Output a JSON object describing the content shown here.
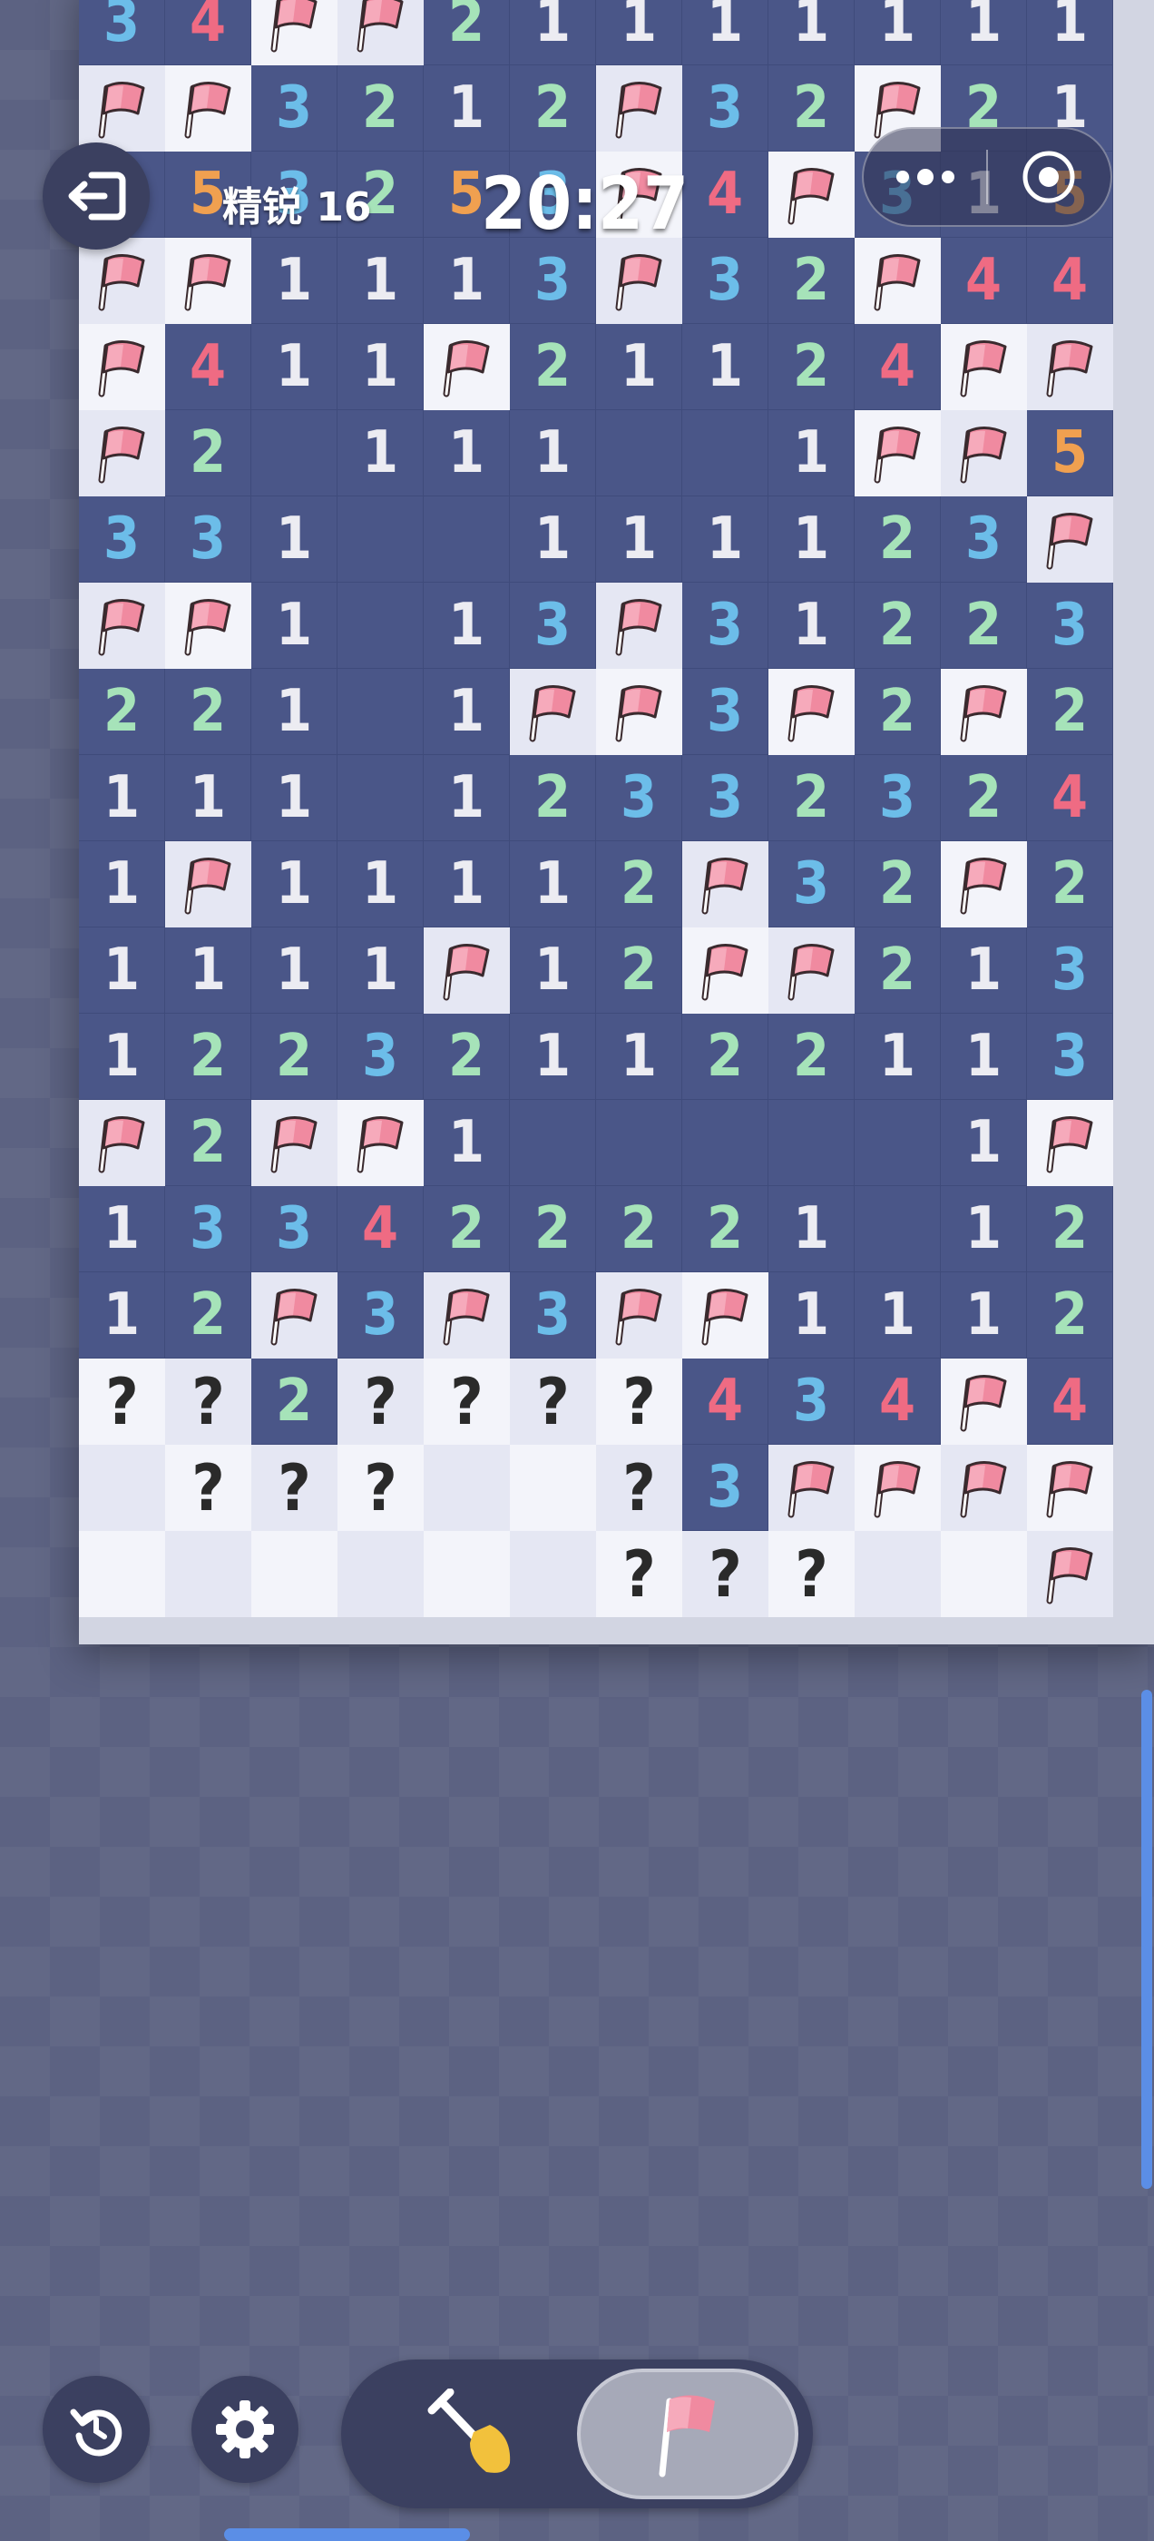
{
  "header": {
    "exit_icon": "exit-icon",
    "level_label": "精锐 16",
    "timer": "20:27",
    "capsule": {
      "more_icon": "more-dots-icon",
      "target_icon": "target-circle-icon"
    }
  },
  "board": {
    "legend": {
      "F": "flag",
      "?": "question-mark",
      ".": "hidden-blank",
      "_": "open-blank",
      "1-5": "number"
    },
    "rows": [
      [
        "3",
        "4",
        "F",
        "F",
        "2",
        "1",
        "1",
        "1",
        "1",
        "1",
        "1",
        "1"
      ],
      [
        "F",
        "F",
        "3",
        "2",
        "1",
        "2",
        "F",
        "3",
        "2",
        "F",
        "2",
        "1"
      ],
      [
        "5",
        "5",
        "3",
        "2",
        "5",
        "3",
        "F",
        "4",
        "F",
        "3",
        "1",
        "5"
      ],
      [
        "F",
        "F",
        "1",
        "1",
        "1",
        "3",
        "F",
        "3",
        "2",
        "F",
        "4",
        "4"
      ],
      [
        "F",
        "4",
        "1",
        "1",
        "F",
        "2",
        "1",
        "1",
        "2",
        "4",
        "F",
        "F"
      ],
      [
        "F",
        "2",
        "_",
        "1",
        "1",
        "1",
        "_",
        "_",
        "1",
        "F",
        "F",
        "5"
      ],
      [
        "3",
        "3",
        "1",
        "_",
        "_",
        "1",
        "1",
        "1",
        "1",
        "2",
        "3",
        "F"
      ],
      [
        "F",
        "F",
        "1",
        "_",
        "1",
        "3",
        "F",
        "3",
        "1",
        "2",
        "2",
        "3"
      ],
      [
        "2",
        "2",
        "1",
        "_",
        "1",
        "F",
        "F",
        "3",
        "F",
        "2",
        "F",
        "2"
      ],
      [
        "1",
        "1",
        "1",
        "_",
        "1",
        "2",
        "3",
        "3",
        "2",
        "3",
        "2",
        "4"
      ],
      [
        "1",
        "F",
        "1",
        "1",
        "1",
        "1",
        "2",
        "F",
        "3",
        "2",
        "F",
        "2"
      ],
      [
        "1",
        "1",
        "1",
        "1",
        "F",
        "1",
        "2",
        "F",
        "F",
        "2",
        "1",
        "3"
      ],
      [
        "1",
        "2",
        "2",
        "3",
        "2",
        "1",
        "1",
        "2",
        "2",
        "1",
        "1",
        "3"
      ],
      [
        "F",
        "2",
        "F",
        "F",
        "1",
        "_",
        "_",
        "_",
        "_",
        "_",
        "1",
        "F"
      ],
      [
        "1",
        "3",
        "3",
        "4",
        "2",
        "2",
        "2",
        "2",
        "1",
        "_",
        "1",
        "2"
      ],
      [
        "1",
        "2",
        "F",
        "3",
        "F",
        "3",
        "F",
        "F",
        "1",
        "1",
        "1",
        "2"
      ],
      [
        "?",
        "?",
        "2",
        "?",
        "?",
        "?",
        "?",
        "4",
        "3",
        "4",
        "F",
        "4"
      ],
      [
        ".",
        "?",
        "?",
        "?",
        ".",
        ".",
        "?",
        "3",
        "F",
        "F",
        "F",
        "F"
      ],
      [
        ".",
        ".",
        ".",
        ".",
        ".",
        ".",
        "?",
        "?",
        "?",
        ".",
        ".",
        "F"
      ]
    ]
  },
  "controls": {
    "undo_icon": "undo-icon",
    "settings_icon": "gear-icon",
    "shovel_icon": "shovel-icon",
    "flag_icon": "flag-icon"
  },
  "colors": {
    "background": "#5c6282",
    "open_cell": "#4a5688",
    "hidden_cell": "#f3f4fa",
    "num_1": "#ececf2",
    "num_2": "#a6e3b9",
    "num_3": "#6cbde9",
    "num_4": "#ef6b83",
    "num_5": "#f0a050",
    "flag": "#f08aa0",
    "accent": "#5b8ee6"
  }
}
